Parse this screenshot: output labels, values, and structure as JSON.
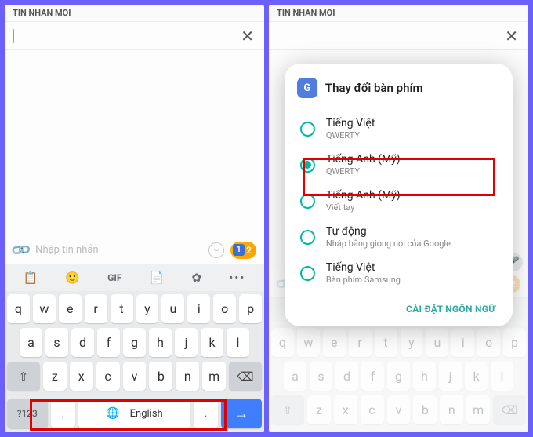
{
  "header": {
    "title": "TIN NHAN MOI"
  },
  "search": {
    "close": "✕"
  },
  "compose": {
    "placeholder": "Nhập tin nhắn",
    "sim": "1",
    "sim_alt": "2"
  },
  "toolbar": {
    "gif": "GIF"
  },
  "keyboard": {
    "row1": [
      "q",
      "w",
      "e",
      "r",
      "t",
      "y",
      "u",
      "i",
      "o",
      "p"
    ],
    "row2": [
      "a",
      "s",
      "d",
      "f",
      "g",
      "h",
      "j",
      "k",
      "l"
    ],
    "row3": [
      "z",
      "x",
      "c",
      "v",
      "b",
      "n",
      "m"
    ],
    "shift": "⇧",
    "backspace": "⌫",
    "numkey": "?123",
    "comma": ",",
    "space_label": "English",
    "period": ".",
    "enter": "→"
  },
  "dialog": {
    "title": "Thay đổi bàn phím",
    "options": [
      {
        "label": "Tiếng Việt",
        "sub": "QWERTY",
        "selected": false
      },
      {
        "label": "Tiếng Anh (Mỹ)",
        "sub": "QWERTY",
        "selected": true
      },
      {
        "label": "Tiếng Anh (Mỹ)",
        "sub": "Viết tay",
        "selected": false
      },
      {
        "label": "Tự động",
        "sub": "Nhập bằng giọng nói của Google",
        "selected": false
      },
      {
        "label": "Tiếng Việt",
        "sub": "Bàn phím Samsung",
        "selected": false
      }
    ],
    "footer": "CÀI ĐẶT NGÔN NGỮ"
  }
}
